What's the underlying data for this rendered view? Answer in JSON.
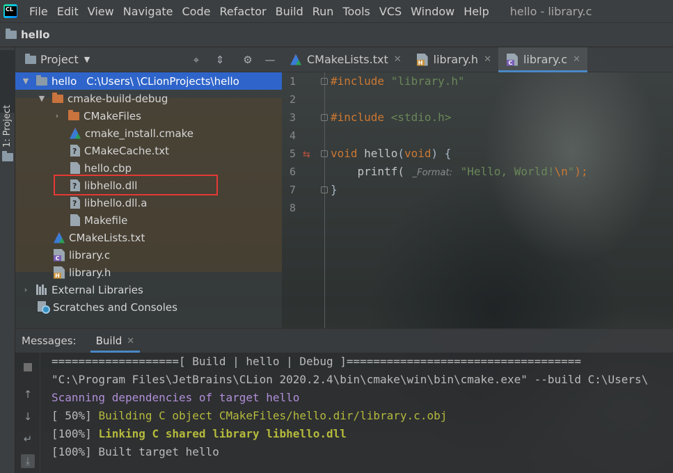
{
  "menubar": {
    "items": [
      "File",
      "Edit",
      "View",
      "Navigate",
      "Code",
      "Refactor",
      "Build",
      "Run",
      "Tools",
      "VCS",
      "Window",
      "Help"
    ],
    "window_title": "hello - library.c"
  },
  "navbar": {
    "project_name": "hello"
  },
  "left_stripe": {
    "project_label": "1: Project"
  },
  "project_panel": {
    "title": "Project",
    "tree": [
      {
        "label": "hello",
        "path": "C:\\Users\\      \\CLionProjects\\hello",
        "icon": "folder-icon"
      },
      {
        "label": "cmake-build-debug",
        "icon": "folder-orange-icon"
      },
      {
        "label": "CMakeFiles",
        "icon": "folder-orange-icon"
      },
      {
        "label": "cmake_install.cmake",
        "icon": "cmake-icon"
      },
      {
        "label": "CMakeCache.txt",
        "icon": "cmake-cache-icon"
      },
      {
        "label": "hello.cbp",
        "icon": "file-icon"
      },
      {
        "label": "libhello.dll",
        "icon": "unknown-file-icon"
      },
      {
        "label": "libhello.dll.a",
        "icon": "unknown-file-icon"
      },
      {
        "label": "Makefile",
        "icon": "file-icon"
      },
      {
        "label": "CMakeLists.txt",
        "icon": "cmake-icon"
      },
      {
        "label": "library.c",
        "icon": "c-file-icon"
      },
      {
        "label": "library.h",
        "icon": "h-file-icon"
      },
      {
        "label": "External Libraries",
        "icon": "library-icon"
      },
      {
        "label": "Scratches and Consoles",
        "icon": "scratch-icon"
      }
    ]
  },
  "editor": {
    "tabs": [
      {
        "label": "CMakeLists.txt",
        "icon": "cmake-icon"
      },
      {
        "label": "library.h",
        "icon": "h-file-icon"
      },
      {
        "label": "library.c",
        "icon": "c-file-icon"
      }
    ],
    "line_numbers": [
      "1",
      "2",
      "3",
      "4",
      "5",
      "6",
      "7",
      "8"
    ],
    "code": {
      "l1_directive": "#include",
      "l1_file": "\"library.h\"",
      "l3_directive": "#include",
      "l3_file": "<stdio.h>",
      "l5_type": "void",
      "l5_name": "hello",
      "l5_paren_open": "(",
      "l5_param": "void",
      "l5_rest": ") {",
      "l6_call": "    printf(",
      "l6_hint": "_Format:",
      "l6_str_a": "\"Hello, World!",
      "l6_esc": "\\n",
      "l6_str_b": "\"",
      "l6_rest": ");",
      "l7": "}"
    }
  },
  "bottom_panel": {
    "messages_label": "Messages:",
    "build_tab": "Build",
    "console": [
      "===================[ Build | hello | Debug ]===================================",
      "\"C:\\Program Files\\JetBrains\\CLion 2020.2.4\\bin\\cmake\\win\\bin\\cmake.exe\" --build C:\\Users\\",
      "Scanning dependencies of target hello",
      "[ 50%] ",
      "Building C object CMakeFiles/hello.dir/library.c.obj",
      "[100%] ",
      "Linking C shared library libhello.dll",
      "[100%] Built target hello"
    ]
  },
  "colors": {
    "accent": "#4a88c7",
    "selection": "#2f65ca",
    "highlight_box": "#e53935",
    "keyword": "#cc7832",
    "string": "#6a8759"
  }
}
